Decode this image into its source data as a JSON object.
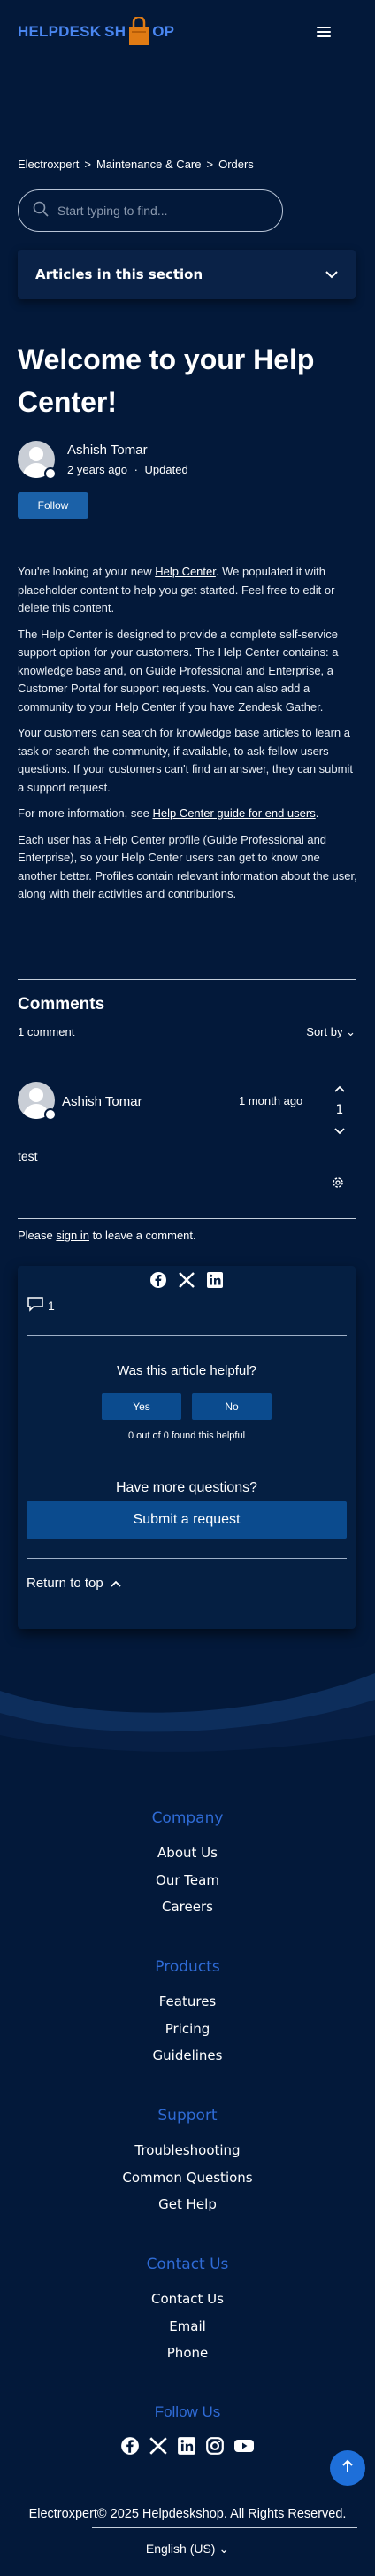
{
  "header": {
    "logo_left": "HELPDESK",
    "logo_right": "OP",
    "logo_s": "SH"
  },
  "breadcrumb": [
    "Electroxpert",
    "Maintenance & Care",
    "Orders"
  ],
  "search": {
    "placeholder": "Start typing to find..."
  },
  "section": {
    "label": "Articles in this section"
  },
  "article": {
    "title": "Welcome to your Help Center!",
    "author": "Ashish Tomar",
    "time": "2 years ago",
    "updated": "Updated",
    "follow": "Follow",
    "p1_pre": "You're looking at your new ",
    "p1_link": "Help Center",
    "p1_post": ". We populated it with placeholder content to help you get started. Feel free to edit or delete this content.",
    "p2": "The Help Center is designed to provide a complete self-service support option for your customers. The Help Center contains: a knowledge base and, on Guide Professional and Enterprise, a Customer Portal for support requests. You can also add a community to your Help Center if you have Zendesk Gather.",
    "p3": "Your customers can search for knowledge base articles to learn a task or search the community, if available, to ask fellow users questions. If your customers can't find an answer, they can submit a support request.",
    "p4_pre": "For more information, see ",
    "p4_link": "Help Center guide for end users",
    "p4_post": ".",
    "p5": "Each user has a Help Center profile (Guide Professional and Enterprise), so your Help Center users can get to know one another better. Profiles contain relevant information about the user, along with their activities and contributions."
  },
  "comments": {
    "heading": "Comments",
    "count": "1 comment",
    "sort": "Sort by",
    "item": {
      "author": "Ashish Tomar",
      "time": "1 month ago",
      "votes": "1",
      "text": "test"
    },
    "signin_pre": "Please ",
    "signin_link": "sign in",
    "signin_post": " to leave a comment."
  },
  "card": {
    "comment_count": "1",
    "helpful": "Was this article helpful?",
    "yes": "Yes",
    "no": "No",
    "found": "0 out of 0 found this helpful",
    "more": "Have more questions?",
    "submit": "Submit a request",
    "return": "Return to top"
  },
  "footer": {
    "company": {
      "title": "Company",
      "links": [
        "About Us",
        "Our Team",
        "Careers"
      ]
    },
    "products": {
      "title": "Products",
      "links": [
        "Features",
        "Pricing",
        "Guidelines"
      ]
    },
    "support": {
      "title": "Support",
      "links": [
        "Troubleshooting",
        "Common Questions",
        "Get Help"
      ]
    },
    "contact": {
      "title": "Contact Us",
      "links": [
        "Contact Us",
        "Email",
        "Phone"
      ]
    },
    "follow_us": "Follow Us",
    "copyright": "Electroxpert© 2025 Helpdeskshop. All Rights Reserved.",
    "language": "English (US)"
  },
  "colors": {
    "background": "#03193a",
    "accent": "#2f6bd6",
    "button": "#0b4b8e"
  }
}
